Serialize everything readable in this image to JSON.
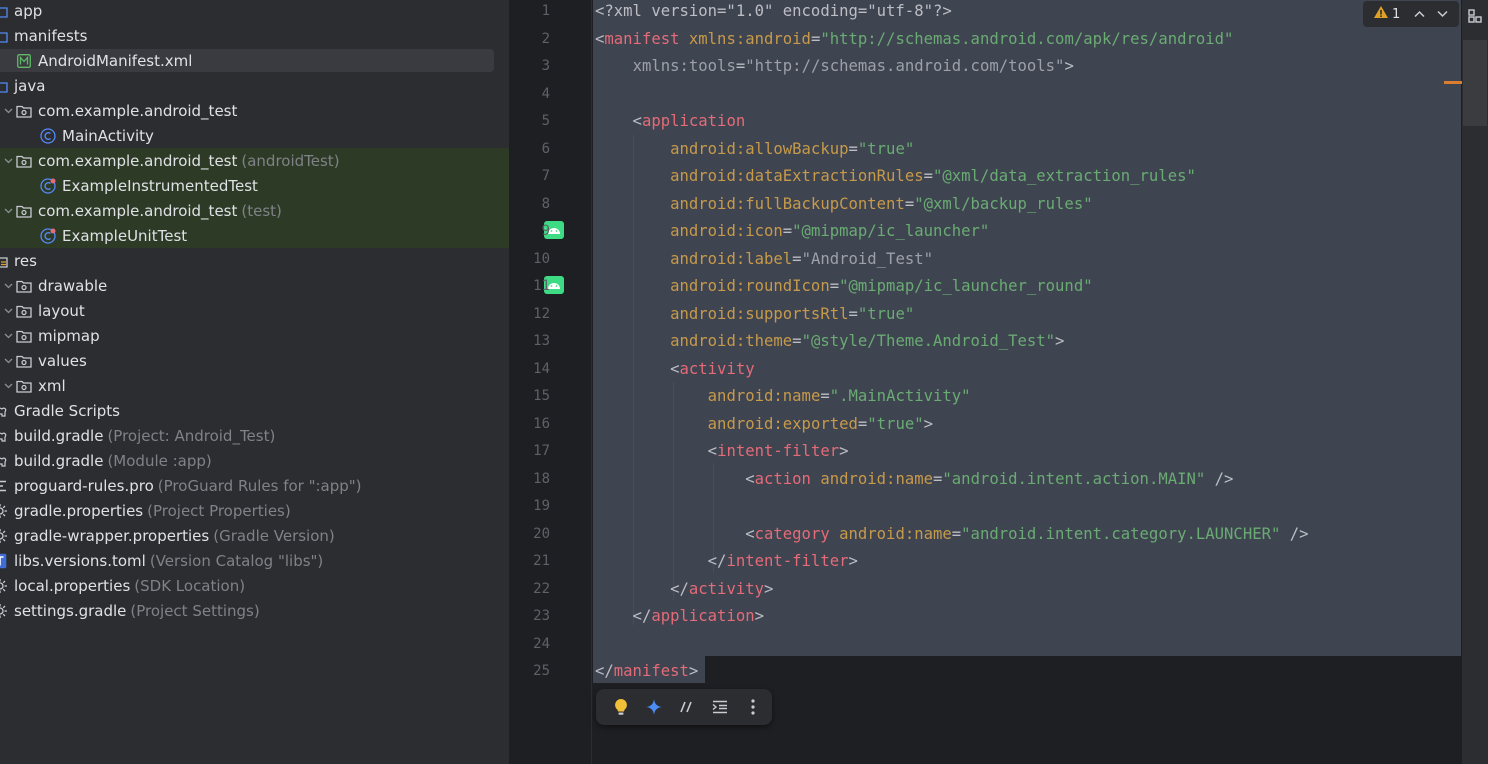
{
  "tree": {
    "items": [
      {
        "label": "app",
        "hint": "",
        "icon": "module-folder-icon"
      },
      {
        "label": "manifests",
        "hint": "",
        "icon": "folder-icon"
      },
      {
        "label": "AndroidManifest.xml",
        "hint": "",
        "icon": "manifest-file-icon"
      },
      {
        "label": "java",
        "hint": "",
        "icon": "source-folder-icon"
      },
      {
        "label": "com.example.android_test",
        "hint": "",
        "icon": "package-icon"
      },
      {
        "label": "MainActivity",
        "hint": "",
        "icon": "class-icon"
      },
      {
        "label": "com.example.android_test",
        "hint": "(androidTest)",
        "icon": "package-icon"
      },
      {
        "label": "ExampleInstrumentedTest",
        "hint": "",
        "icon": "test-class-icon"
      },
      {
        "label": "com.example.android_test",
        "hint": "(test)",
        "icon": "package-icon"
      },
      {
        "label": "ExampleUnitTest",
        "hint": "",
        "icon": "test-class-icon"
      },
      {
        "label": "res",
        "hint": "",
        "icon": "resources-folder-icon"
      },
      {
        "label": "drawable",
        "hint": "",
        "icon": "package-icon"
      },
      {
        "label": "layout",
        "hint": "",
        "icon": "package-icon"
      },
      {
        "label": "mipmap",
        "hint": "",
        "icon": "package-icon"
      },
      {
        "label": "values",
        "hint": "",
        "icon": "package-icon"
      },
      {
        "label": "xml",
        "hint": "",
        "icon": "package-icon"
      },
      {
        "label": "Gradle Scripts",
        "hint": "",
        "icon": "gradle-scripts-icon"
      },
      {
        "label": "build.gradle",
        "hint": "(Project: Android_Test)",
        "icon": "gradle-file-icon"
      },
      {
        "label": "build.gradle",
        "hint": "(Module :app)",
        "icon": "gradle-file-icon"
      },
      {
        "label": "proguard-rules.pro",
        "hint": "(ProGuard Rules for \":app\")",
        "icon": "text-file-icon"
      },
      {
        "label": "gradle.properties",
        "hint": "(Project Properties)",
        "icon": "properties-file-icon"
      },
      {
        "label": "gradle-wrapper.properties",
        "hint": "(Gradle Version)",
        "icon": "properties-file-icon"
      },
      {
        "label": "libs.versions.toml",
        "hint": "(Version Catalog \"libs\")",
        "icon": "toml-file-icon"
      },
      {
        "label": "local.properties",
        "hint": "(SDK Location)",
        "icon": "properties-file-icon"
      },
      {
        "label": "settings.gradle",
        "hint": "(Project Settings)",
        "icon": "properties-file-icon"
      }
    ]
  },
  "editor": {
    "line_numbers": [
      "1",
      "2",
      "3",
      "4",
      "5",
      "6",
      "7",
      "8",
      "9",
      "10",
      "11",
      "12",
      "13",
      "14",
      "15",
      "16",
      "17",
      "18",
      "19",
      "20",
      "21",
      "22",
      "23",
      "24",
      "25"
    ],
    "lines": [
      [
        [
          "p",
          "<?xml version=\"1.0\" encoding=\"utf-8\"?>"
        ]
      ],
      [
        [
          "p",
          "<"
        ],
        [
          "t",
          "manifest"
        ],
        [
          "p",
          " "
        ],
        [
          "a",
          "xmlns:android"
        ],
        [
          "p",
          "="
        ],
        [
          "v",
          "\"http://schemas.android.com/apk/res/android\""
        ]
      ],
      [
        [
          "p",
          "    "
        ],
        [
          "g",
          "xmlns:tools"
        ],
        [
          "p",
          "="
        ],
        [
          "g",
          "\"http://schemas.android.com/tools\""
        ],
        [
          "p",
          ">"
        ]
      ],
      [],
      [
        [
          "p",
          "    <"
        ],
        [
          "t",
          "application"
        ]
      ],
      [
        [
          "p",
          "        "
        ],
        [
          "a",
          "android:allowBackup"
        ],
        [
          "p",
          "="
        ],
        [
          "v",
          "\"true\""
        ]
      ],
      [
        [
          "p",
          "        "
        ],
        [
          "a",
          "android:dataExtractionRules"
        ],
        [
          "p",
          "="
        ],
        [
          "v",
          "\"@xml/data_extraction_rules\""
        ]
      ],
      [
        [
          "p",
          "        "
        ],
        [
          "a",
          "android:fullBackupContent"
        ],
        [
          "p",
          "="
        ],
        [
          "v",
          "\"@xml/backup_rules\""
        ]
      ],
      [
        [
          "p",
          "        "
        ],
        [
          "a",
          "android:icon"
        ],
        [
          "p",
          "="
        ],
        [
          "v",
          "\"@mipmap/ic_launcher\""
        ]
      ],
      [
        [
          "p",
          "        "
        ],
        [
          "a",
          "android:label"
        ],
        [
          "p",
          "="
        ],
        [
          "g",
          "\"Android_Test\""
        ]
      ],
      [
        [
          "p",
          "        "
        ],
        [
          "a",
          "android:roundIcon"
        ],
        [
          "p",
          "="
        ],
        [
          "v",
          "\"@mipmap/ic_launcher_round\""
        ]
      ],
      [
        [
          "p",
          "        "
        ],
        [
          "a",
          "android:supportsRtl"
        ],
        [
          "p",
          "="
        ],
        [
          "v",
          "\"true\""
        ]
      ],
      [
        [
          "p",
          "        "
        ],
        [
          "a",
          "android:theme"
        ],
        [
          "p",
          "="
        ],
        [
          "v",
          "\"@style/Theme.Android_Test\""
        ],
        [
          "p",
          ">"
        ]
      ],
      [
        [
          "p",
          "        <"
        ],
        [
          "t",
          "activity"
        ]
      ],
      [
        [
          "p",
          "            "
        ],
        [
          "a",
          "android:name"
        ],
        [
          "p",
          "="
        ],
        [
          "v",
          "\".MainActivity\""
        ]
      ],
      [
        [
          "p",
          "            "
        ],
        [
          "a",
          "android:exported"
        ],
        [
          "p",
          "="
        ],
        [
          "v",
          "\"true\""
        ],
        [
          "p",
          ">"
        ]
      ],
      [
        [
          "p",
          "            <"
        ],
        [
          "t",
          "intent-filter"
        ],
        [
          "p",
          ">"
        ]
      ],
      [
        [
          "p",
          "                <"
        ],
        [
          "t",
          "action"
        ],
        [
          "p",
          " "
        ],
        [
          "a",
          "android:name"
        ],
        [
          "p",
          "="
        ],
        [
          "v",
          "\"android.intent.action.MAIN\""
        ],
        [
          "p",
          " />"
        ]
      ],
      [],
      [
        [
          "p",
          "                <"
        ],
        [
          "t",
          "category"
        ],
        [
          "p",
          " "
        ],
        [
          "a",
          "android:name"
        ],
        [
          "p",
          "="
        ],
        [
          "v",
          "\"android.intent.category.LAUNCHER\""
        ],
        [
          "p",
          " />"
        ]
      ],
      [
        [
          "p",
          "            </"
        ],
        [
          "t",
          "intent-filter"
        ],
        [
          "p",
          ">"
        ]
      ],
      [
        [
          "p",
          "        </"
        ],
        [
          "t",
          "activity"
        ],
        [
          "p",
          ">"
        ]
      ],
      [
        [
          "p",
          "    </"
        ],
        [
          "t",
          "application"
        ],
        [
          "p",
          ">"
        ]
      ],
      [],
      [
        [
          "p",
          "</"
        ],
        [
          "t",
          "manifest"
        ],
        [
          "p",
          ">"
        ]
      ]
    ]
  },
  "inspections": {
    "warnings": "1",
    "icon": "warning-icon",
    "prev_icon": "chevron-up-icon",
    "next_icon": "chevron-down-icon"
  },
  "floating_toolbar": {
    "buttons": [
      "lightbulb-icon",
      "ai-assistant-icon",
      "comment-icon",
      "reformat-icon",
      "more-icon"
    ]
  },
  "colors": {
    "tag": "#e46b78",
    "attribute": "#c69a4a",
    "value": "#6aab73",
    "selection": "#3f4451",
    "test_row": "#2d3a26",
    "android_green": "#3ddc84",
    "warning": "#e0a127"
  }
}
